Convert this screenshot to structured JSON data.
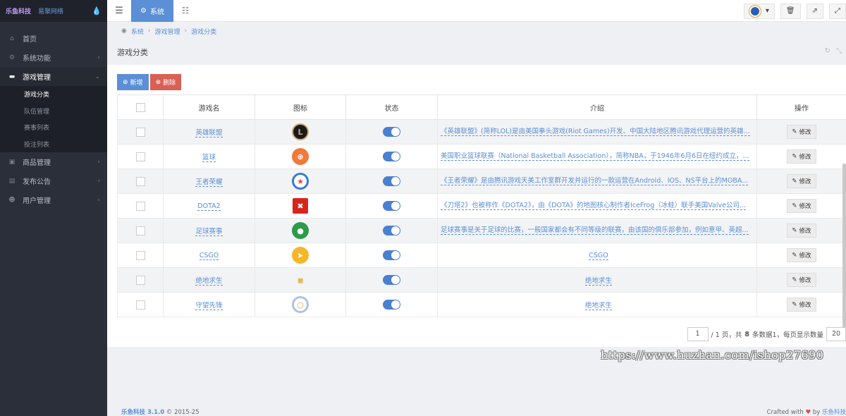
{
  "brand": {
    "logo_primary": "乐鱼科技",
    "logo_secondary": "易聚网络"
  },
  "sidebar": {
    "items": [
      {
        "label": "首页",
        "icon": "home-icon"
      },
      {
        "label": "系统功能",
        "icon": "gear-icon"
      },
      {
        "label": "游戏管理",
        "icon": "gamepad-icon"
      },
      {
        "label": "商品管理",
        "icon": "shop-icon"
      },
      {
        "label": "发布公告",
        "icon": "notice-icon"
      },
      {
        "label": "用户管理",
        "icon": "users-icon"
      }
    ],
    "subitems": [
      "游戏分类",
      "队伍管理",
      "赛事列表",
      "投注列表"
    ]
  },
  "topbar": {
    "tab_label": "系统"
  },
  "breadcrumb": [
    "系统",
    "游戏管理",
    "游戏分类"
  ],
  "page_title": "游戏分类",
  "toolbar": {
    "add_label": "新增",
    "delete_label": "删除"
  },
  "table": {
    "headers": [
      "游戏名",
      "图标",
      "状态",
      "介绍",
      "操作"
    ],
    "edit_label": "修改",
    "rows": [
      {
        "name": "英雄联盟",
        "icon": "lol-icon",
        "intro": "《英雄联盟》(简称LOL)是由美国拳头游戏(Riot Games)开发、中国大陆地区腾讯游戏代理运营的英雄..."
      },
      {
        "name": "篮球",
        "icon": "basketball-icon",
        "intro": "美国职业篮球联赛（National Basketball Association），简称NBA，于1946年6月6日在纽约成立，..."
      },
      {
        "name": "王者荣耀",
        "icon": "kog-icon",
        "intro": "《王者荣耀》是由腾讯游戏天美工作室群开发并运行的一款运营在Android、IOS、NS平台上的MOBA..."
      },
      {
        "name": "DOTA2",
        "icon": "dota2-icon",
        "intro": "《刀塔2》也被称作《DOTA2》，由《DOTA》的地图核心制作者IceFrog（冰蛙）联手美国Valve公司..."
      },
      {
        "name": "足球赛事",
        "icon": "football-icon",
        "intro": "足球赛事是关于足球的比赛，一般国家都会有不同等级的联赛，由该国的俱乐部参加，例如意甲、英超..."
      },
      {
        "name": "CSGO",
        "icon": "csgo-icon",
        "intro": "CSGO"
      },
      {
        "name": "绝地求生",
        "icon": "pubg-icon",
        "intro": "绝地求生"
      },
      {
        "name": "守望先锋",
        "icon": "overwatch-icon",
        "intro": "绝地求生"
      }
    ]
  },
  "pager": {
    "current": "1",
    "summary_a": "/ 1 页，共",
    "total": "8",
    "summary_b": "条数据1，每页显示数量",
    "page_size": "20"
  },
  "watermark": "https://www.huzhan.com/ishop27690",
  "footer": {
    "brand": "乐鱼科技 3.1.0",
    "copyright": "© 2015-25",
    "crafted": "Crafted with",
    "by": "by",
    "author": "乐鱼科技"
  },
  "colors": {
    "accent": "#5b8fd6",
    "danger": "#d96055",
    "sidebar": "#2b2f3a"
  }
}
